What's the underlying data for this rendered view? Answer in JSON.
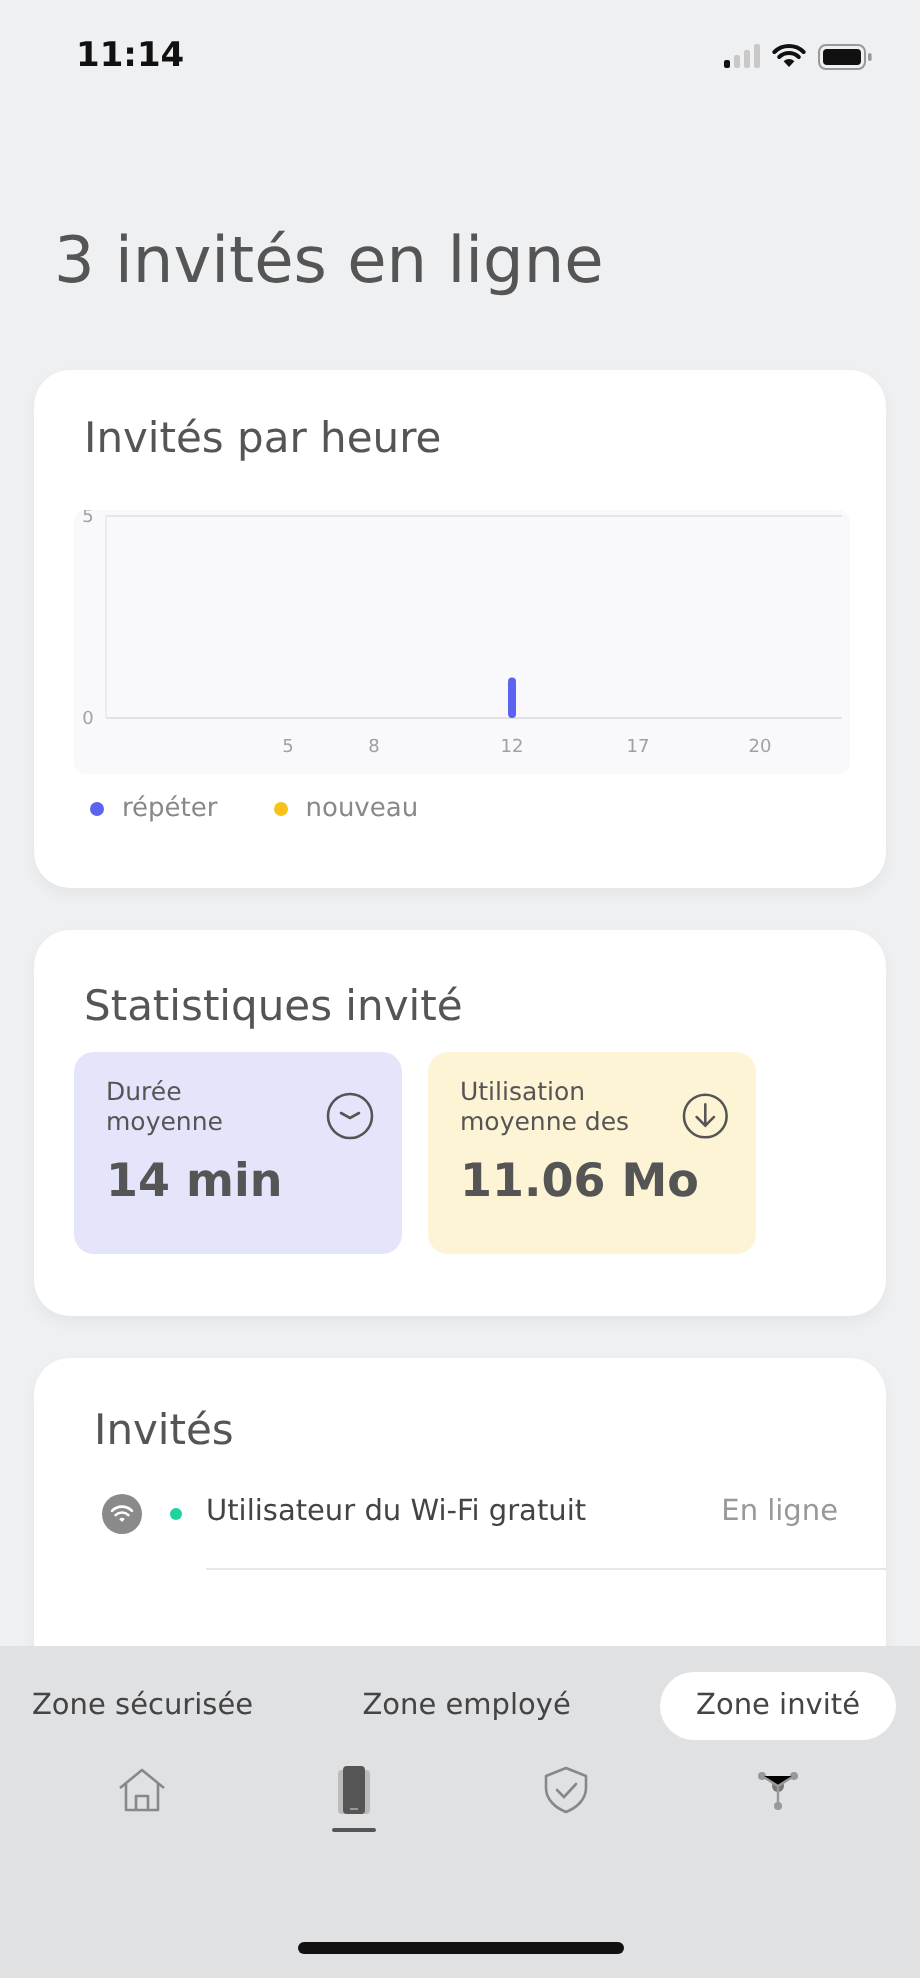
{
  "status_bar": {
    "time": "11:14"
  },
  "title": "3 invités en ligne",
  "hourly_card": {
    "title": "Invités par heure",
    "chart_data": {
      "type": "bar",
      "categories": [
        "5",
        "8",
        "12",
        "17",
        "20"
      ],
      "ylim": [
        0,
        5
      ],
      "yticks": [
        0,
        5
      ],
      "stacked": true,
      "series": [
        {
          "name": "répéter",
          "color": "#5b63f0",
          "values": [
            0,
            0,
            1,
            0,
            0
          ]
        },
        {
          "name": "nouveau",
          "color": "#f7c21a",
          "values": [
            0,
            0,
            0,
            0,
            0
          ]
        }
      ]
    }
  },
  "stats_card": {
    "title": "Statistiques invité",
    "tiles": [
      {
        "label": "Durée moyenne",
        "value": "14 min",
        "kind": "clock",
        "color": "#e4e4fb"
      },
      {
        "label": "Utilisation moyenne des",
        "value": "11.06 Mo",
        "kind": "download",
        "color": "#fcf4d4"
      }
    ]
  },
  "guests_card": {
    "title": "Invités",
    "rows": [
      {
        "name": "Utilisateur du Wi-Fi gratuit",
        "status": "En ligne",
        "online": true
      }
    ]
  },
  "zone_tabs": [
    {
      "label": "Zone sécurisée",
      "selected": false
    },
    {
      "label": "Zone employé",
      "selected": false
    },
    {
      "label": "Zone invité",
      "selected": true
    }
  ],
  "nav_tabs": [
    {
      "kind": "home",
      "selected": false
    },
    {
      "kind": "devices",
      "selected": true
    },
    {
      "kind": "shield",
      "selected": false
    },
    {
      "kind": "network",
      "selected": false
    }
  ]
}
